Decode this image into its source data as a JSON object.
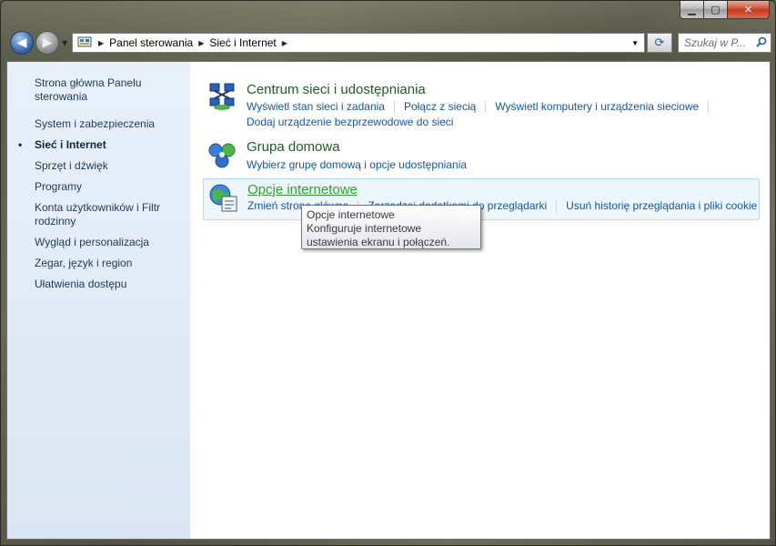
{
  "window": {
    "controls": {
      "minimize": "▁",
      "maximize": "▢",
      "close": "✕"
    }
  },
  "nav": {
    "back_icon": "back-arrow-icon",
    "forward_icon": "forward-arrow-icon",
    "breadcrumb": [
      "Panel sterowania",
      "Sieć i Internet"
    ],
    "search_placeholder": "Szukaj w P..."
  },
  "sidebar": {
    "home": "Strona główna Panelu sterowania",
    "items": [
      {
        "label": "System i zabezpieczenia",
        "active": false
      },
      {
        "label": "Sieć i Internet",
        "active": true
      },
      {
        "label": "Sprzęt i dźwięk",
        "active": false
      },
      {
        "label": "Programy",
        "active": false
      },
      {
        "label": "Konta użytkowników i Filtr rodzinny",
        "active": false
      },
      {
        "label": "Wygląd i personalizacja",
        "active": false
      },
      {
        "label": "Zegar, język i region",
        "active": false
      },
      {
        "label": "Ułatwienia dostępu",
        "active": false
      }
    ]
  },
  "categories": [
    {
      "title": "Centrum sieci i udostępniania",
      "icon": "network-center-icon",
      "links": [
        [
          "Wyświetl stan sieci i zadania",
          "Połącz z siecią",
          "Wyświetl komputery i urządzenia sieciowe"
        ],
        [
          "Dodaj urządzenie bezprzewodowe do sieci"
        ]
      ]
    },
    {
      "title": "Grupa domowa",
      "icon": "homegroup-icon",
      "links": [
        [
          "Wybierz grupę domową i opcje udostępniania"
        ]
      ]
    },
    {
      "title": "Opcje internetowe",
      "icon": "internet-options-icon",
      "hovered": true,
      "links": [
        [
          "Zmień stronę główną",
          "Zarządzaj dodatkami do przeglądarki",
          "Usuń historię przeglądania i pliki cookie"
        ]
      ]
    }
  ],
  "tooltip": {
    "title": "Opcje internetowe",
    "body": "Konfiguruje internetowe ustawienia ekranu i połączeń."
  },
  "colors": {
    "link": "#1556a6",
    "category_title": "#1e5e1e",
    "sidebar_text": "#1e395b"
  }
}
